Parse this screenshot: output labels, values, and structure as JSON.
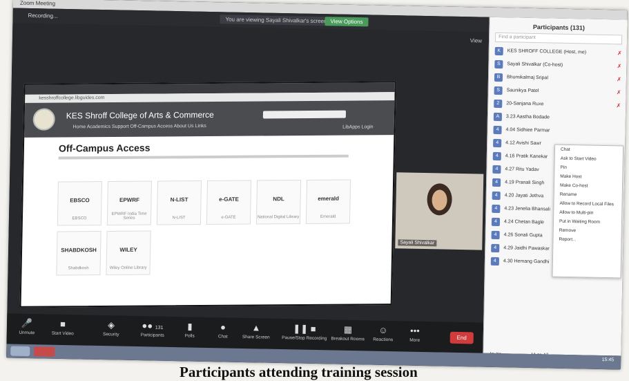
{
  "window": {
    "title": "Zoom Meeting",
    "recording": "Recording..."
  },
  "topbar": {
    "notice": "You are viewing Sayali Shivalkar's screen",
    "view_options": "View Options"
  },
  "stage": {
    "view_label": "View"
  },
  "browser": {
    "url": "kesshroffcollege.libguides.com"
  },
  "site": {
    "college": "KES Shroff College of Arts & Commerce",
    "nav": "Home   Academics   Support   Off-Campus Access   About Us   Links",
    "signin": "LibApps Login",
    "page_title": "Off-Campus Access",
    "tiles": [
      {
        "name": "EBSCO",
        "sub": "EBSCO"
      },
      {
        "name": "EPWRF",
        "sub": "EPWRF India Time Series"
      },
      {
        "name": "N-LIST",
        "sub": "N-LIST"
      },
      {
        "name": "e-GATE",
        "sub": "e-GATE"
      },
      {
        "name": "NDL",
        "sub": "National Digital Library"
      },
      {
        "name": "emerald",
        "sub": "Emerald"
      },
      {
        "name": "SHABDKOSH",
        "sub": "Shabdkosh"
      },
      {
        "name": "WILEY",
        "sub": "Wiley Online Library"
      }
    ]
  },
  "presenter": {
    "name": "Sayali Shivalkar"
  },
  "toolbar": {
    "items": [
      "Unmute",
      "Start Video",
      "Security",
      "Participants",
      "Polls",
      "Chat",
      "Share Screen",
      "Pause/Stop Recording",
      "Breakout Rooms",
      "Reactions",
      "More"
    ],
    "participant_count": "131",
    "end": "End"
  },
  "panel": {
    "title": "Participants (131)",
    "search_placeholder": "Find a participant",
    "participants": [
      "KES SHROFF COLLEGE (Host, me)",
      "Sayali Shivalkar (Co-host)",
      "Bhumikalmaj Sripal",
      "Saunikya Patel",
      "20-Sanjana Ruxe",
      "3.23 Aastha Bodade",
      "4.04 Sidhiee Parmar",
      "4.12 Avishi Sawr",
      "4.16 Pratik Kanekar",
      "4.27 Ritu Yadav",
      "4.19 Pranali Singh",
      "4.20 Jayati Jethva",
      "4.23 Jenelia Bhansali",
      "4.24 Chetan Bagle",
      "4.26 Sonali Gupta",
      "4.29 Jaidhi Pawaskar",
      "4.30 Hemang Gandhi"
    ],
    "mute_all": "Mute All",
    "invite": "Invite"
  },
  "menu": {
    "items": [
      "Chat",
      "Ask to Start Video",
      "Pin",
      "Make Host",
      "Make Co-host",
      "Rename",
      "Allow to Record Local Files",
      "Allow to Multi-pin",
      "Put in Waiting Room",
      "Remove",
      "Report..."
    ]
  },
  "taskbar": {
    "clock": "15:45"
  },
  "caption": "Participants attending training session"
}
